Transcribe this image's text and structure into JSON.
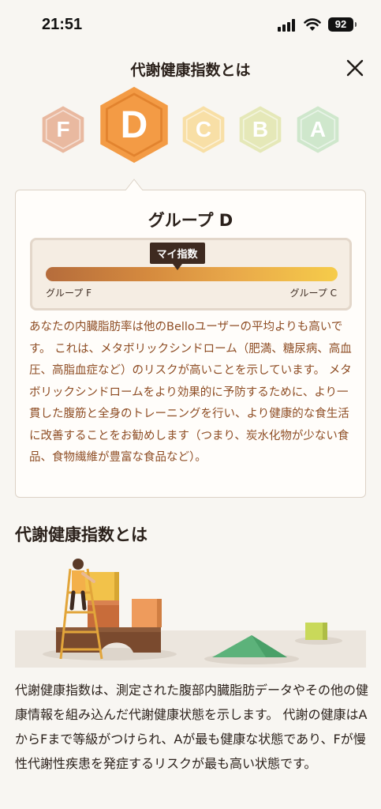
{
  "status_bar": {
    "time": "21:51",
    "battery": "92"
  },
  "header": {
    "title": "代謝健康指数とは"
  },
  "grades": [
    {
      "letter": "F",
      "color": "#e9b9a0",
      "active": false
    },
    {
      "letter": "D",
      "color": "#f39b45",
      "active": true
    },
    {
      "letter": "C",
      "color": "#f8dfa6",
      "active": false
    },
    {
      "letter": "B",
      "color": "#e5e8b8",
      "active": false
    },
    {
      "letter": "A",
      "color": "#cfe7cc",
      "active": false
    }
  ],
  "card": {
    "title": "グループ D",
    "gauge": {
      "marker_label": "マイ指数",
      "marker_position": 0.45,
      "left_label": "グループ F",
      "right_label": "グループ C"
    },
    "description": "あなたの内臓脂肪率は他のBelloユーザーの平均よりも高いです。 これは、メタボリックシンドローム（肥満、糖尿病、高血圧、高脂血症など）のリスクが高いことを示しています。 メタボリックシンドロームをより効果的に予防するために、より一貫した腹筋と全身のトレーニングを行い、より健康的な食生活に改善することをお勧めします（つまり、炭水化物が少ない食品、食物繊維が豊富な食品など）。"
  },
  "section": {
    "title": "代謝健康指数とは",
    "body": "代謝健康指数は、測定された腹部内臓脂肪データやその他の健康情報を組み込んだ代謝健康状態を示します。 代謝の健康はAからFまで等級がつけられ、Aが最も健康な状態であり、Fが慢性代謝性疾患を発症するリスクが最も高い状態です。"
  }
}
